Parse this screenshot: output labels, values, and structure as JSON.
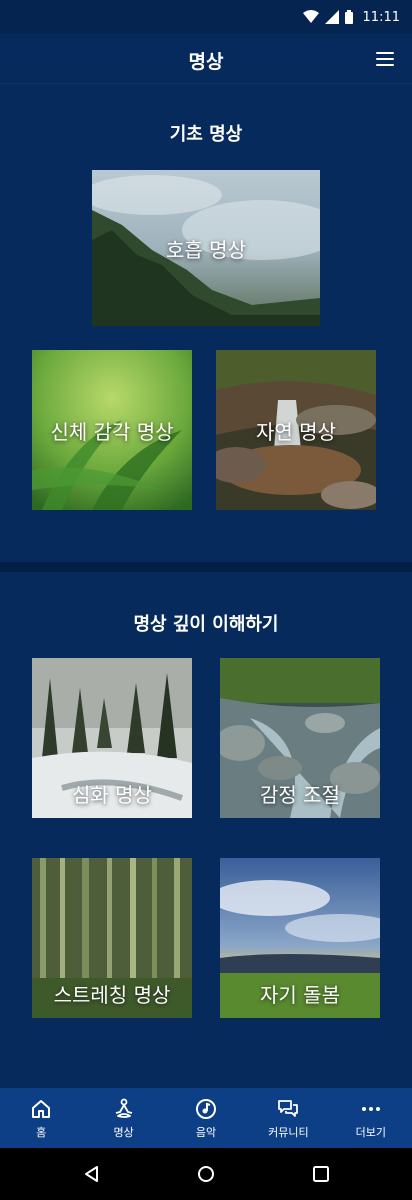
{
  "status_bar": {
    "time": "11:11",
    "icons": [
      "wifi-icon",
      "signal-icon",
      "battery-icon"
    ]
  },
  "app_bar": {
    "title": "명상",
    "menu_icon": "hamburger-menu-icon"
  },
  "sections": [
    {
      "title": "기초 명상",
      "cards": [
        {
          "label": "호흡 명상",
          "image": "misty forest mountain"
        },
        {
          "label": "신체 감각 명상",
          "image": "green grass blades"
        },
        {
          "label": "자연 명상",
          "image": "small waterfall over rocks"
        }
      ]
    },
    {
      "title": "명상 깊이 이해하기",
      "cards": [
        {
          "label": "심화 명상",
          "image": "snowy pine forest"
        },
        {
          "label": "감정 조절",
          "image": "mountain stream rocks"
        },
        {
          "label": "스트레칭 명상",
          "image": "bamboo forest"
        },
        {
          "label": "자기 돌봄",
          "image": "sky with clouds over meadow"
        }
      ]
    }
  ],
  "bottom_nav": [
    {
      "label": "홈",
      "icon": "home-icon"
    },
    {
      "label": "명상",
      "icon": "meditation-icon"
    },
    {
      "label": "음악",
      "icon": "music-icon"
    },
    {
      "label": "커뮤니티",
      "icon": "chat-icon"
    },
    {
      "label": "더보기",
      "icon": "more-icon"
    }
  ],
  "system_nav": [
    "back-icon",
    "home-circle-icon",
    "recents-icon"
  ],
  "colors": {
    "background": "#062a5c",
    "bottom_nav": "#0d3f86",
    "text": "#ffffff"
  }
}
